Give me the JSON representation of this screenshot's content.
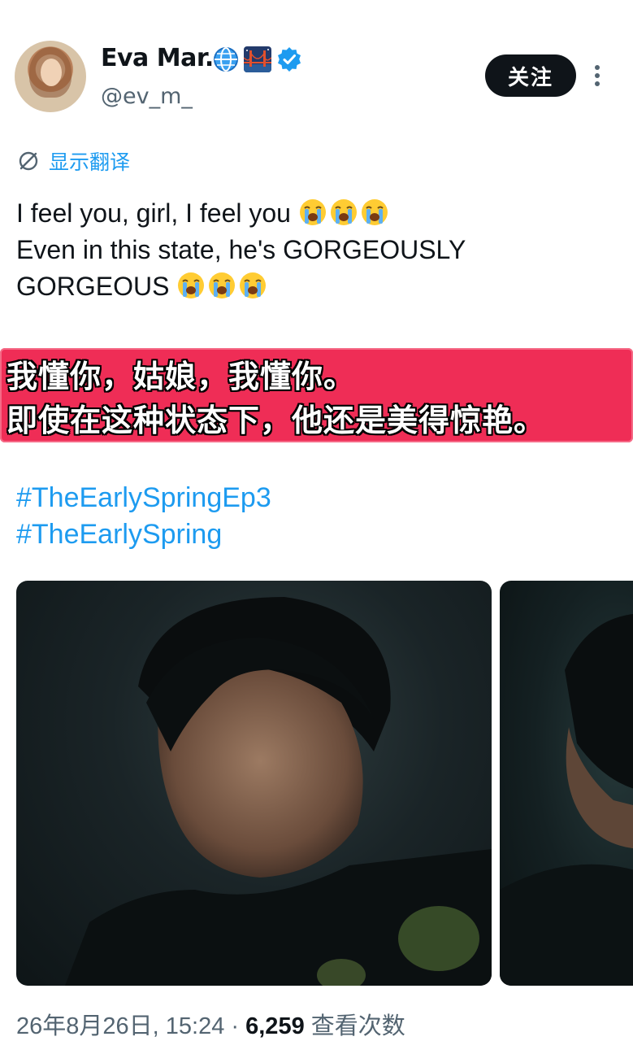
{
  "author": {
    "display_name": "Eva Mar.",
    "handle": "@ev_m_",
    "avatar_icon": "profile-photo"
  },
  "header": {
    "follow_label": "关注",
    "more_icon": "more-vertical-icon"
  },
  "translate": {
    "label": "显示翻译"
  },
  "tweet": {
    "line1": "I feel you, girl, I feel you",
    "line2": "Even in this state, he's GORGEOUSLY",
    "line3": "GORGEOUS",
    "emoji": "loudly-crying-face"
  },
  "translation_banner": {
    "line1": "我懂你，姑娘，我懂你。",
    "line2": "即使在这种状态下，他还是美得惊艳。",
    "color": "#ef2d56"
  },
  "hashtags": [
    "#TheEarlySpringEp3",
    "#TheEarlySpring"
  ],
  "media": {
    "count_visible": 2,
    "description_icon": "photo"
  },
  "meta": {
    "timestamp": "26年8月26日, 15:24",
    "separator": "·",
    "views_count": "6,259",
    "views_label": "查看次数"
  },
  "colors": {
    "accent": "#1d9bf0",
    "text": "#0f1419",
    "muted": "#536471"
  }
}
